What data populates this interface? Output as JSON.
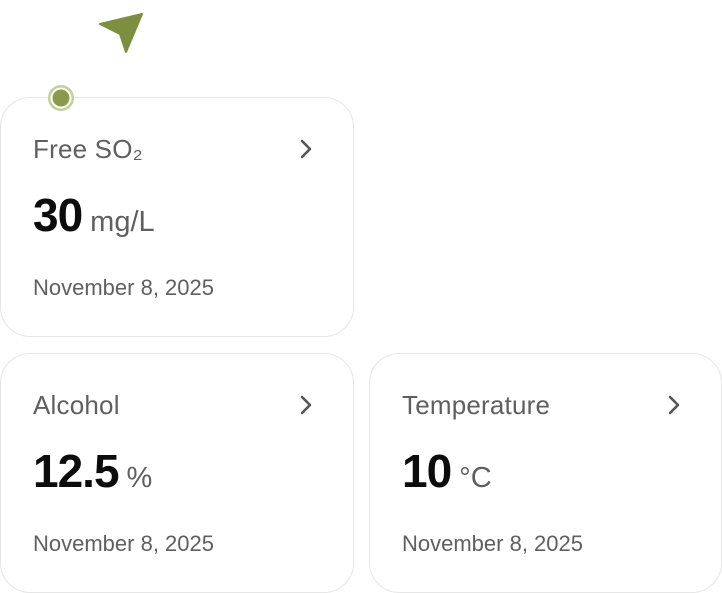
{
  "colors": {
    "accent": "#8a9a4a",
    "accent_light": "#b5c27a",
    "card_border": "#e6e6e6",
    "text_muted": "#5f5f5f",
    "text_strong": "#0c0c0c"
  },
  "overlay": {
    "cursor_icon": "navigation-arrow-icon",
    "pointer_icon": "pointer-dot-icon"
  },
  "cards": [
    {
      "title": "Free SO₂",
      "value": "30",
      "unit": "mg/L",
      "date": "November 8, 2025",
      "icon": "chevron-right-icon"
    },
    {
      "title": "Alcohol",
      "value": "12.5",
      "unit": "%",
      "date": "November 8, 2025",
      "icon": "chevron-right-icon"
    },
    {
      "title": "Temperature",
      "value": "10",
      "unit": "°C",
      "date": "November 8, 2025",
      "icon": "chevron-right-icon"
    }
  ]
}
